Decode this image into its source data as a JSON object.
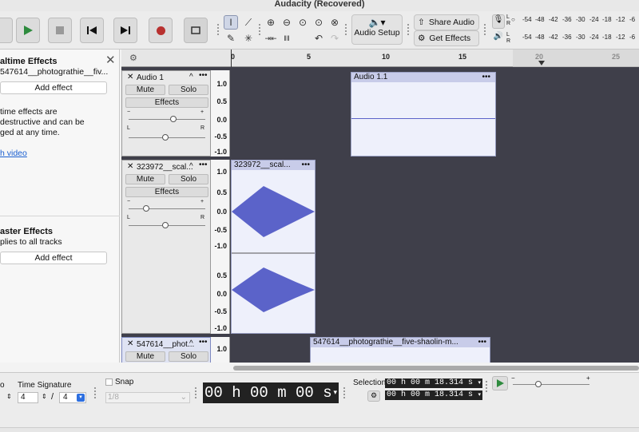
{
  "window": {
    "title": "Audacity (Recovered)"
  },
  "toolbar": {
    "share_audio": "Share Audio",
    "get_effects": "Get Effects",
    "audio_setup": "Audio Setup",
    "meter_scale": [
      "-54",
      "-48",
      "-42",
      "-36",
      "-30",
      "-24",
      "-18",
      "-12",
      "-6"
    ],
    "meter_channels": [
      "L",
      "R"
    ]
  },
  "effects_panel": {
    "realtime_title": "altime Effects",
    "track_name": "547614__photograthie__fiv...",
    "add_effect": "Add effect",
    "description": [
      "time effects are",
      "destructive and can be",
      "ged at any time."
    ],
    "watch_link": "h video",
    "master_title": "aster Effects",
    "master_desc": "plies to all tracks",
    "master_add": "Add effect"
  },
  "ruler": {
    "ticks": [
      "0",
      "5",
      "10",
      "15",
      "20",
      "25"
    ]
  },
  "tracks": [
    {
      "name": "Audio 1",
      "mute": "Mute",
      "solo": "Solo",
      "effects": "Effects",
      "clip_name": "Audio 1.1",
      "scale": [
        "1.0",
        "0.5",
        "0.0",
        "-0.5",
        "-1.0"
      ]
    },
    {
      "name": "323972__scal...",
      "mute": "Mute",
      "solo": "Solo",
      "effects": "Effects",
      "clip_name": "323972__scal...",
      "scale": [
        "1.0",
        "0.5",
        "0.0",
        "-0.5",
        "-1.0",
        "0.5",
        "0.0",
        "-0.5",
        "-1.0"
      ]
    },
    {
      "name": "547614__phot...",
      "mute": "Mute",
      "solo": "Solo",
      "clip_name": "547614__photograthie__five-shaolin-m...",
      "scale": [
        "1.0"
      ]
    }
  ],
  "gain_labels": {
    "minus": "−",
    "plus": "+",
    "left": "L",
    "right": "R"
  },
  "bottom": {
    "time_signature_label": "Time Signature",
    "tempo_partial": "o",
    "ts_num": "4",
    "ts_slash": "/",
    "ts_den": "4",
    "snap_label": "Snap",
    "snap_value": "1/8",
    "time_display": "00 h 00 m 00 s",
    "selection_label": "Selection",
    "sel_start": "00 h 00 m 18.314 s",
    "sel_end": "00 h 00 m 18.314 s"
  },
  "colors": {
    "waveform": "#5b63c9",
    "clip_bg": "#eef0fb",
    "track_bg": "#3f3f4a",
    "record": "#b8312f",
    "play": "#2e8b3e"
  }
}
